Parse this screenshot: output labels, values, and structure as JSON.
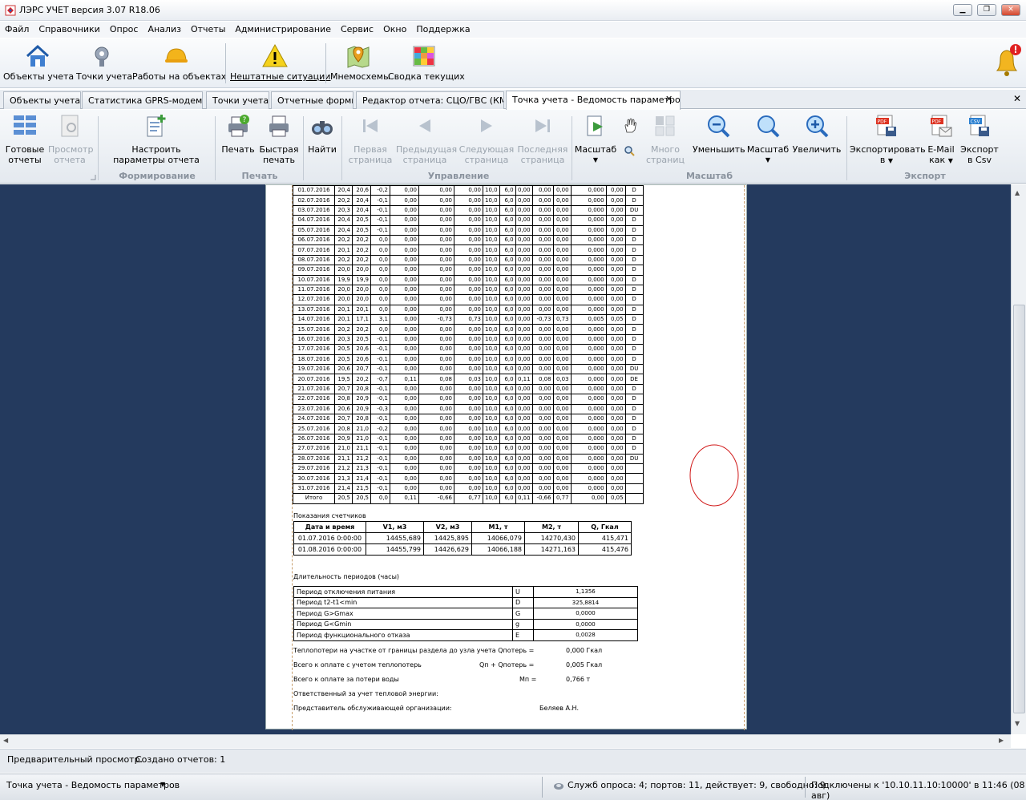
{
  "window": {
    "title": "ЛЭРС УЧЕТ версия 3.07 R18.06",
    "min": "▁",
    "max": "❐",
    "close": "✕"
  },
  "menu": [
    "Файл",
    "Справочники",
    "Опрос",
    "Анализ",
    "Отчеты",
    "Администрирование",
    "Сервис",
    "Окно",
    "Поддержка"
  ],
  "toolbar": [
    "Объекты учета",
    "Точки учета",
    "Работы на объектах",
    "Нештатные ситуации",
    "Мнемосхемы",
    "Сводка текущих"
  ],
  "tabs": [
    "Объекты учета",
    "Статистика GPRS-модемов",
    "Точки учета",
    "Отчетные формы",
    "Редактор отчета: СЦО/ГВС (КМ)",
    "Точка учета - Ведомость параметро"
  ],
  "ribbon": {
    "ready1": "Готовые",
    "ready2": "отчеты",
    "view1": "Просмотр",
    "view2": "отчета",
    "cfg1": "Настроить",
    "cfg2": "параметры отчета",
    "print1": "Печать",
    "fast1": "Быстрая",
    "fast2": "печать",
    "find": "Найти",
    "first1": "Первая",
    "first2": "страница",
    "prev1": "Предыдущая",
    "prev2": "страница",
    "next1": "Следующая",
    "next2": "страница",
    "last1": "Последняя",
    "last2": "страница",
    "scale": "Масштаб",
    "many1": "Много",
    "many2": "страниц",
    "zoomout": "Уменьшить",
    "scale2": "Масштаб",
    "zoomin": "Увеличить",
    "exp1": "Экспортировать",
    "exp2": "в",
    "mail1": "E-Mail",
    "mail2": "как",
    "csv1": "Экспорт",
    "csv2": "в Csv",
    "g1": "Формирование отчета",
    "g2": "Печать",
    "g3": "Управление",
    "g4": "Масштаб",
    "g5": "Экспорт"
  },
  "rows": [
    [
      "01.07.2016",
      "20,4",
      "20,6",
      "-0,2",
      "0,00",
      "0,00",
      "0,00",
      "10,0",
      "6,0",
      "0,00",
      "0,00",
      "0,00",
      "0,000",
      "0,00",
      "D"
    ],
    [
      "02.07.2016",
      "20,2",
      "20,4",
      "-0,1",
      "0,00",
      "0,00",
      "0,00",
      "10,0",
      "6,0",
      "0,00",
      "0,00",
      "0,00",
      "0,000",
      "0,00",
      "D"
    ],
    [
      "03.07.2016",
      "20,3",
      "20,4",
      "-0,1",
      "0,00",
      "0,00",
      "0,00",
      "10,0",
      "6,0",
      "0,00",
      "0,00",
      "0,00",
      "0,000",
      "0,00",
      "DU"
    ],
    [
      "04.07.2016",
      "20,4",
      "20,5",
      "-0,1",
      "0,00",
      "0,00",
      "0,00",
      "10,0",
      "6,0",
      "0,00",
      "0,00",
      "0,00",
      "0,000",
      "0,00",
      "D"
    ],
    [
      "05.07.2016",
      "20,4",
      "20,5",
      "-0,1",
      "0,00",
      "0,00",
      "0,00",
      "10,0",
      "6,0",
      "0,00",
      "0,00",
      "0,00",
      "0,000",
      "0,00",
      "D"
    ],
    [
      "06.07.2016",
      "20,2",
      "20,2",
      "0,0",
      "0,00",
      "0,00",
      "0,00",
      "10,0",
      "6,0",
      "0,00",
      "0,00",
      "0,00",
      "0,000",
      "0,00",
      "D"
    ],
    [
      "07.07.2016",
      "20,1",
      "20,2",
      "0,0",
      "0,00",
      "0,00",
      "0,00",
      "10,0",
      "6,0",
      "0,00",
      "0,00",
      "0,00",
      "0,000",
      "0,00",
      "D"
    ],
    [
      "08.07.2016",
      "20,2",
      "20,2",
      "0,0",
      "0,00",
      "0,00",
      "0,00",
      "10,0",
      "6,0",
      "0,00",
      "0,00",
      "0,00",
      "0,000",
      "0,00",
      "D"
    ],
    [
      "09.07.2016",
      "20,0",
      "20,0",
      "0,0",
      "0,00",
      "0,00",
      "0,00",
      "10,0",
      "6,0",
      "0,00",
      "0,00",
      "0,00",
      "0,000",
      "0,00",
      "D"
    ],
    [
      "10.07.2016",
      "19,9",
      "19,9",
      "0,0",
      "0,00",
      "0,00",
      "0,00",
      "10,0",
      "6,0",
      "0,00",
      "0,00",
      "0,00",
      "0,000",
      "0,00",
      "D"
    ],
    [
      "11.07.2016",
      "20,0",
      "20,0",
      "0,0",
      "0,00",
      "0,00",
      "0,00",
      "10,0",
      "6,0",
      "0,00",
      "0,00",
      "0,00",
      "0,000",
      "0,00",
      "D"
    ],
    [
      "12.07.2016",
      "20,0",
      "20,0",
      "0,0",
      "0,00",
      "0,00",
      "0,00",
      "10,0",
      "6,0",
      "0,00",
      "0,00",
      "0,00",
      "0,000",
      "0,00",
      "D"
    ],
    [
      "13.07.2016",
      "20,1",
      "20,1",
      "0,0",
      "0,00",
      "0,00",
      "0,00",
      "10,0",
      "6,0",
      "0,00",
      "0,00",
      "0,00",
      "0,000",
      "0,00",
      "D"
    ],
    [
      "14.07.2016",
      "20,1",
      "17,1",
      "3,1",
      "0,00",
      "-0,73",
      "0,73",
      "10,0",
      "6,0",
      "0,00",
      "-0,73",
      "0,73",
      "0,005",
      "0,05",
      "D"
    ],
    [
      "15.07.2016",
      "20,2",
      "20,2",
      "0,0",
      "0,00",
      "0,00",
      "0,00",
      "10,0",
      "6,0",
      "0,00",
      "0,00",
      "0,00",
      "0,000",
      "0,00",
      "D"
    ],
    [
      "16.07.2016",
      "20,3",
      "20,5",
      "-0,1",
      "0,00",
      "0,00",
      "0,00",
      "10,0",
      "6,0",
      "0,00",
      "0,00",
      "0,00",
      "0,000",
      "0,00",
      "D"
    ],
    [
      "17.07.2016",
      "20,5",
      "20,6",
      "-0,1",
      "0,00",
      "0,00",
      "0,00",
      "10,0",
      "6,0",
      "0,00",
      "0,00",
      "0,00",
      "0,000",
      "0,00",
      "D"
    ],
    [
      "18.07.2016",
      "20,5",
      "20,6",
      "-0,1",
      "0,00",
      "0,00",
      "0,00",
      "10,0",
      "6,0",
      "0,00",
      "0,00",
      "0,00",
      "0,000",
      "0,00",
      "D"
    ],
    [
      "19.07.2016",
      "20,6",
      "20,7",
      "-0,1",
      "0,00",
      "0,00",
      "0,00",
      "10,0",
      "6,0",
      "0,00",
      "0,00",
      "0,00",
      "0,000",
      "0,00",
      "DU"
    ],
    [
      "20.07.2016",
      "19,5",
      "20,2",
      "-0,7",
      "0,11",
      "0,08",
      "0,03",
      "10,0",
      "6,0",
      "0,11",
      "0,08",
      "0,03",
      "0,000",
      "0,00",
      "DE"
    ],
    [
      "21.07.2016",
      "20,7",
      "20,8",
      "-0,1",
      "0,00",
      "0,00",
      "0,00",
      "10,0",
      "6,0",
      "0,00",
      "0,00",
      "0,00",
      "0,000",
      "0,00",
      "D"
    ],
    [
      "22.07.2016",
      "20,8",
      "20,9",
      "-0,1",
      "0,00",
      "0,00",
      "0,00",
      "10,0",
      "6,0",
      "0,00",
      "0,00",
      "0,00",
      "0,000",
      "0,00",
      "D"
    ],
    [
      "23.07.2016",
      "20,6",
      "20,9",
      "-0,3",
      "0,00",
      "0,00",
      "0,00",
      "10,0",
      "6,0",
      "0,00",
      "0,00",
      "0,00",
      "0,000",
      "0,00",
      "D"
    ],
    [
      "24.07.2016",
      "20,7",
      "20,8",
      "-0,1",
      "0,00",
      "0,00",
      "0,00",
      "10,0",
      "6,0",
      "0,00",
      "0,00",
      "0,00",
      "0,000",
      "0,00",
      "D"
    ],
    [
      "25.07.2016",
      "20,8",
      "21,0",
      "-0,2",
      "0,00",
      "0,00",
      "0,00",
      "10,0",
      "6,0",
      "0,00",
      "0,00",
      "0,00",
      "0,000",
      "0,00",
      "D"
    ],
    [
      "26.07.2016",
      "20,9",
      "21,0",
      "-0,1",
      "0,00",
      "0,00",
      "0,00",
      "10,0",
      "6,0",
      "0,00",
      "0,00",
      "0,00",
      "0,000",
      "0,00",
      "D"
    ],
    [
      "27.07.2016",
      "21,0",
      "21,1",
      "-0,1",
      "0,00",
      "0,00",
      "0,00",
      "10,0",
      "6,0",
      "0,00",
      "0,00",
      "0,00",
      "0,000",
      "0,00",
      "D"
    ],
    [
      "28.07.2016",
      "21,1",
      "21,2",
      "-0,1",
      "0,00",
      "0,00",
      "0,00",
      "10,0",
      "6,0",
      "0,00",
      "0,00",
      "0,00",
      "0,000",
      "0,00",
      "DU"
    ],
    [
      "29.07.2016",
      "21,2",
      "21,3",
      "-0,1",
      "0,00",
      "0,00",
      "0,00",
      "10,0",
      "6,0",
      "0,00",
      "0,00",
      "0,00",
      "0,000",
      "0,00",
      ""
    ],
    [
      "30.07.2016",
      "21,3",
      "21,4",
      "-0,1",
      "0,00",
      "0,00",
      "0,00",
      "10,0",
      "6,0",
      "0,00",
      "0,00",
      "0,00",
      "0,000",
      "0,00",
      ""
    ],
    [
      "31.07.2016",
      "21,4",
      "21,5",
      "-0,1",
      "0,00",
      "0,00",
      "0,00",
      "10,0",
      "6,0",
      "0,00",
      "0,00",
      "0,00",
      "0,000",
      "0,00",
      ""
    ],
    [
      "Итого",
      "20,5",
      "20,5",
      "0,0",
      "0,11",
      "-0,66",
      "0,77",
      "10,0",
      "6,0",
      "0,11",
      "-0,66",
      "0,77",
      "0,00",
      "0,05",
      ""
    ]
  ],
  "meters": {
    "title": "Показания счетчиков",
    "headers": [
      "Дата и время",
      "V1, м3",
      "V2, м3",
      "M1, т",
      "M2, т",
      "Q, Гкал"
    ],
    "rows": [
      [
        "01.07.2016 0:00:00",
        "14455,689",
        "14425,895",
        "14066,079",
        "14270,430",
        "415,471"
      ],
      [
        "01.08.2016 0:00:00",
        "14455,799",
        "14426,629",
        "14066,188",
        "14271,163",
        "415,476"
      ]
    ]
  },
  "periods": {
    "title": "Длительность периодов (часы)",
    "rows": [
      [
        "Период отключения питания",
        "U",
        "1,1356"
      ],
      [
        "Период t2-t1<min",
        "D",
        "325,8814"
      ],
      [
        "Период G>Gmax",
        "G",
        "0,0000"
      ],
      [
        "Период G<Gmin",
        "g",
        "0,0000"
      ],
      [
        "Период функционального отказа",
        "E",
        "0,0028"
      ]
    ]
  },
  "footer": {
    "l1a": "Теплопотери на участке от границы раздела до узла учета Qпотерь =",
    "l1b": "0,000 Гкал",
    "l2a": "Всего к оплате с учетом теплопотерь",
    "l2m": "Qп + Qпотерь  =",
    "l2b": "0,005 Гкал",
    "l3a": "Всего к оплате за потери воды",
    "l3m": "Mп  =",
    "l3b": "0,766 т",
    "l4": "Ответственный за учет тепловой энергии:",
    "l5a": "Представитель обслуживающей организации:",
    "l5b": "Беляев А.Н."
  },
  "status": {
    "preview": "Предварительный просмотр.",
    "created": "Создано отчетов: 1",
    "window": "Точка учета - Ведомость параметров",
    "poll": "Служб опроса: 4; портов: 11, действует: 9, свободно: 9",
    "conn": "Подключены к '10.10.11.10:10000' в 11:46 (08 авг)"
  },
  "colors": {
    "workspace": "#243a5e",
    "accent": "#1e5aa8",
    "alert": "#e02020"
  }
}
